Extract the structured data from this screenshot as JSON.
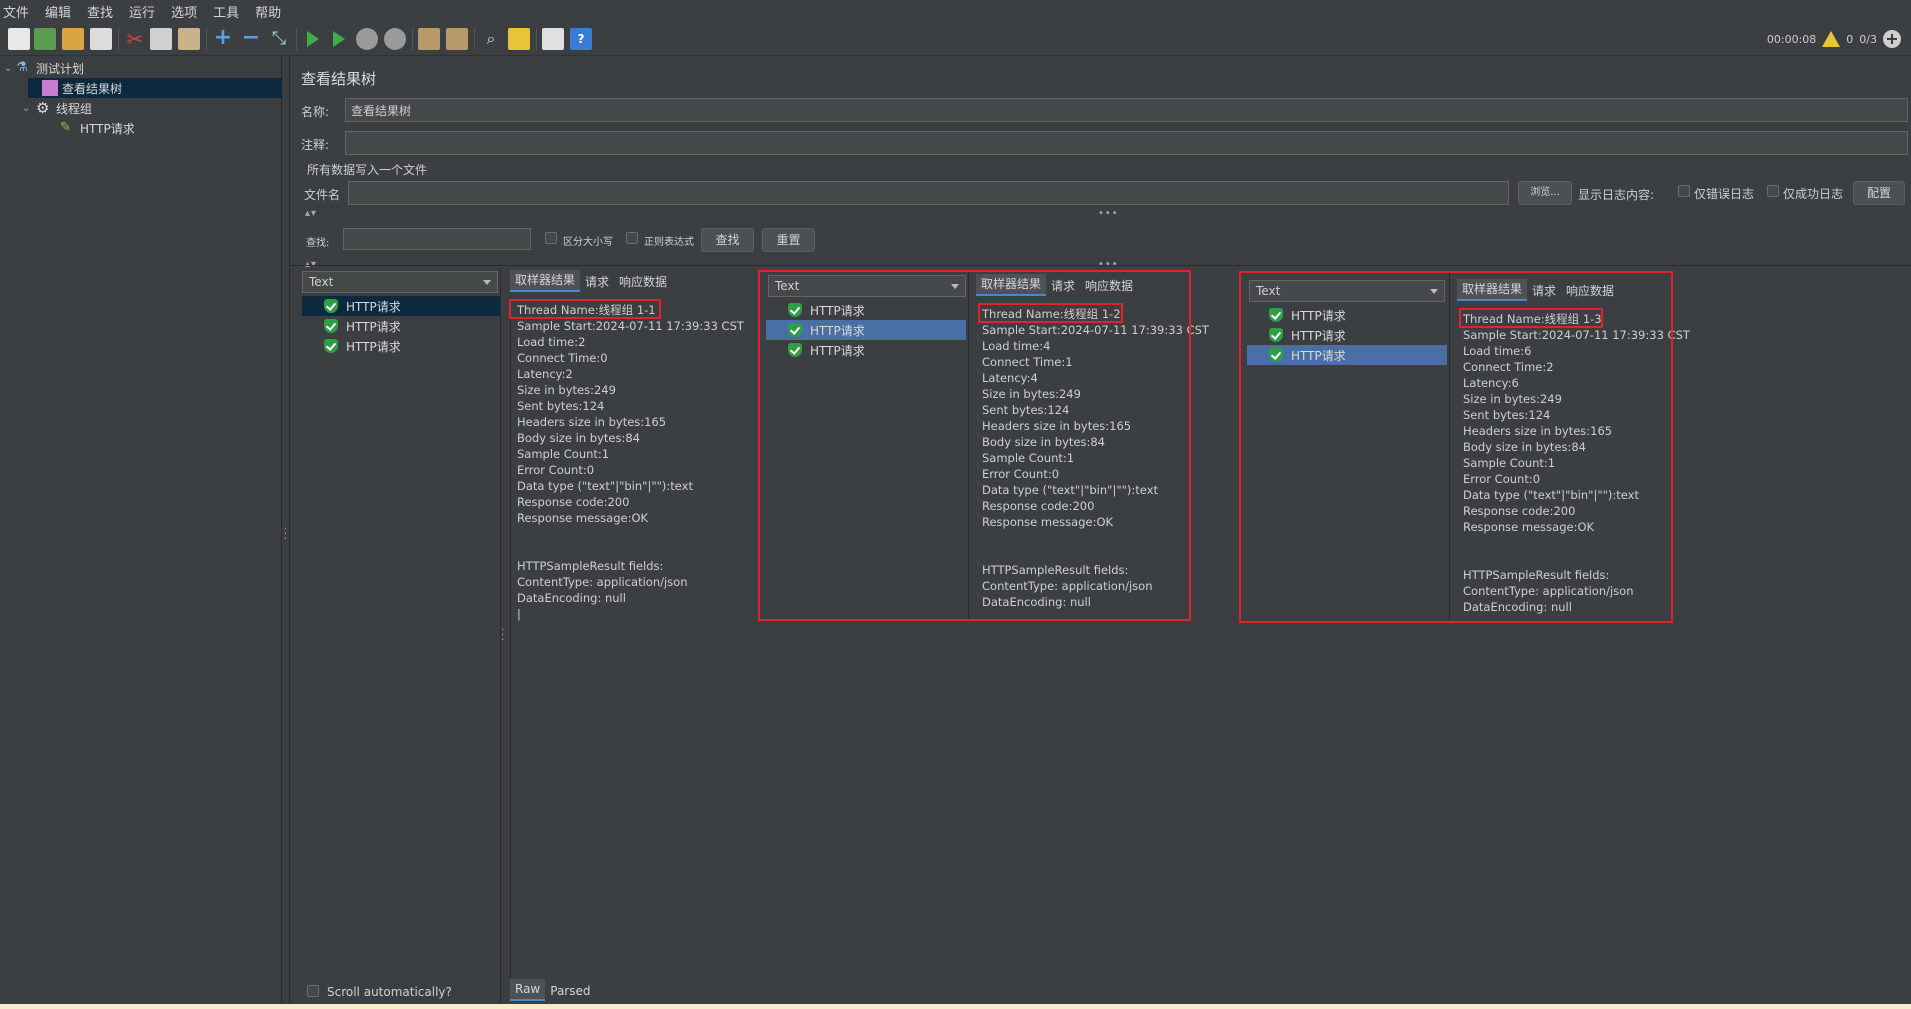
{
  "menu": [
    "文件",
    "编辑",
    "查找",
    "运行",
    "选项",
    "工具",
    "帮助"
  ],
  "status": {
    "timer": "00:00:08",
    "warnings": "0",
    "threads": "0/3"
  },
  "tree": {
    "items": [
      {
        "label": "测试计划",
        "icon": "flask-icon"
      },
      {
        "label": "查看结果树",
        "icon": "chart-icon"
      },
      {
        "label": "线程组",
        "icon": "gear-icon"
      },
      {
        "label": "HTTP请求",
        "icon": "pipette-icon"
      }
    ]
  },
  "panel": {
    "title": "查看结果树",
    "name_label": "名称:",
    "name_value": "查看结果树",
    "comment_label": "注释:",
    "file_section": "所有数据写入一个文件",
    "filename_label": "文件名",
    "browse": "浏览...",
    "log_label": "显示日志内容:",
    "errors_only": "仅错误日志",
    "success_only": "仅成功日志",
    "config": "配置",
    "search_label": "查找:",
    "case_sensitive": "区分大小写",
    "regex": "正则表达式",
    "search_btn": "查找",
    "reset_btn": "重置",
    "renderer": "Text",
    "scroll_auto": "Scroll automatically?",
    "raw_tab": "Raw",
    "parsed_tab": "Parsed"
  },
  "results": {
    "list": [
      "HTTP请求",
      "HTTP请求",
      "HTTP请求"
    ],
    "tabs": [
      "取样器结果",
      "请求",
      "响应数据"
    ]
  },
  "samples": [
    {
      "thread": "Thread Name:线程组 1-1",
      "start": "Sample Start:2024-07-11 17:39:33 CST",
      "load": "Load time:2",
      "connect": "Connect Time:0",
      "latency": "Latency:2",
      "size": "Size in bytes:249",
      "sent": "Sent bytes:124",
      "headers": "Headers size in bytes:165",
      "body": "Body size in bytes:84",
      "count": "Sample Count:1",
      "errors": "Error Count:0",
      "dtype": "Data type (\"text\"|\"bin\"|\"\"):text",
      "code": "Response code:200",
      "msg": "Response message:OK",
      "fields": "HTTPSampleResult fields:",
      "ctype": "ContentType: application/json",
      "enc": "DataEncoding: null"
    },
    {
      "thread": "Thread Name:线程组 1-2",
      "start": "Sample Start:2024-07-11 17:39:33 CST",
      "load": "Load time:4",
      "connect": "Connect Time:1",
      "latency": "Latency:4",
      "size": "Size in bytes:249",
      "sent": "Sent bytes:124",
      "headers": "Headers size in bytes:165",
      "body": "Body size in bytes:84",
      "count": "Sample Count:1",
      "errors": "Error Count:0",
      "dtype": "Data type (\"text\"|\"bin\"|\"\"):text",
      "code": "Response code:200",
      "msg": "Response message:OK",
      "fields": "HTTPSampleResult fields:",
      "ctype": "ContentType: application/json",
      "enc": "DataEncoding: null"
    },
    {
      "thread": "Thread Name:线程组 1-3",
      "start": "Sample Start:2024-07-11 17:39:33 CST",
      "load": "Load time:6",
      "connect": "Connect Time:2",
      "latency": "Latency:6",
      "size": "Size in bytes:249",
      "sent": "Sent bytes:124",
      "headers": "Headers size in bytes:165",
      "body": "Body size in bytes:84",
      "count": "Sample Count:1",
      "errors": "Error Count:0",
      "dtype": "Data type (\"text\"|\"bin\"|\"\"):text",
      "code": "Response code:200",
      "msg": "Response message:OK",
      "fields": "HTTPSampleResult fields:",
      "ctype": "ContentType: application/json",
      "enc": "DataEncoding: null"
    }
  ]
}
